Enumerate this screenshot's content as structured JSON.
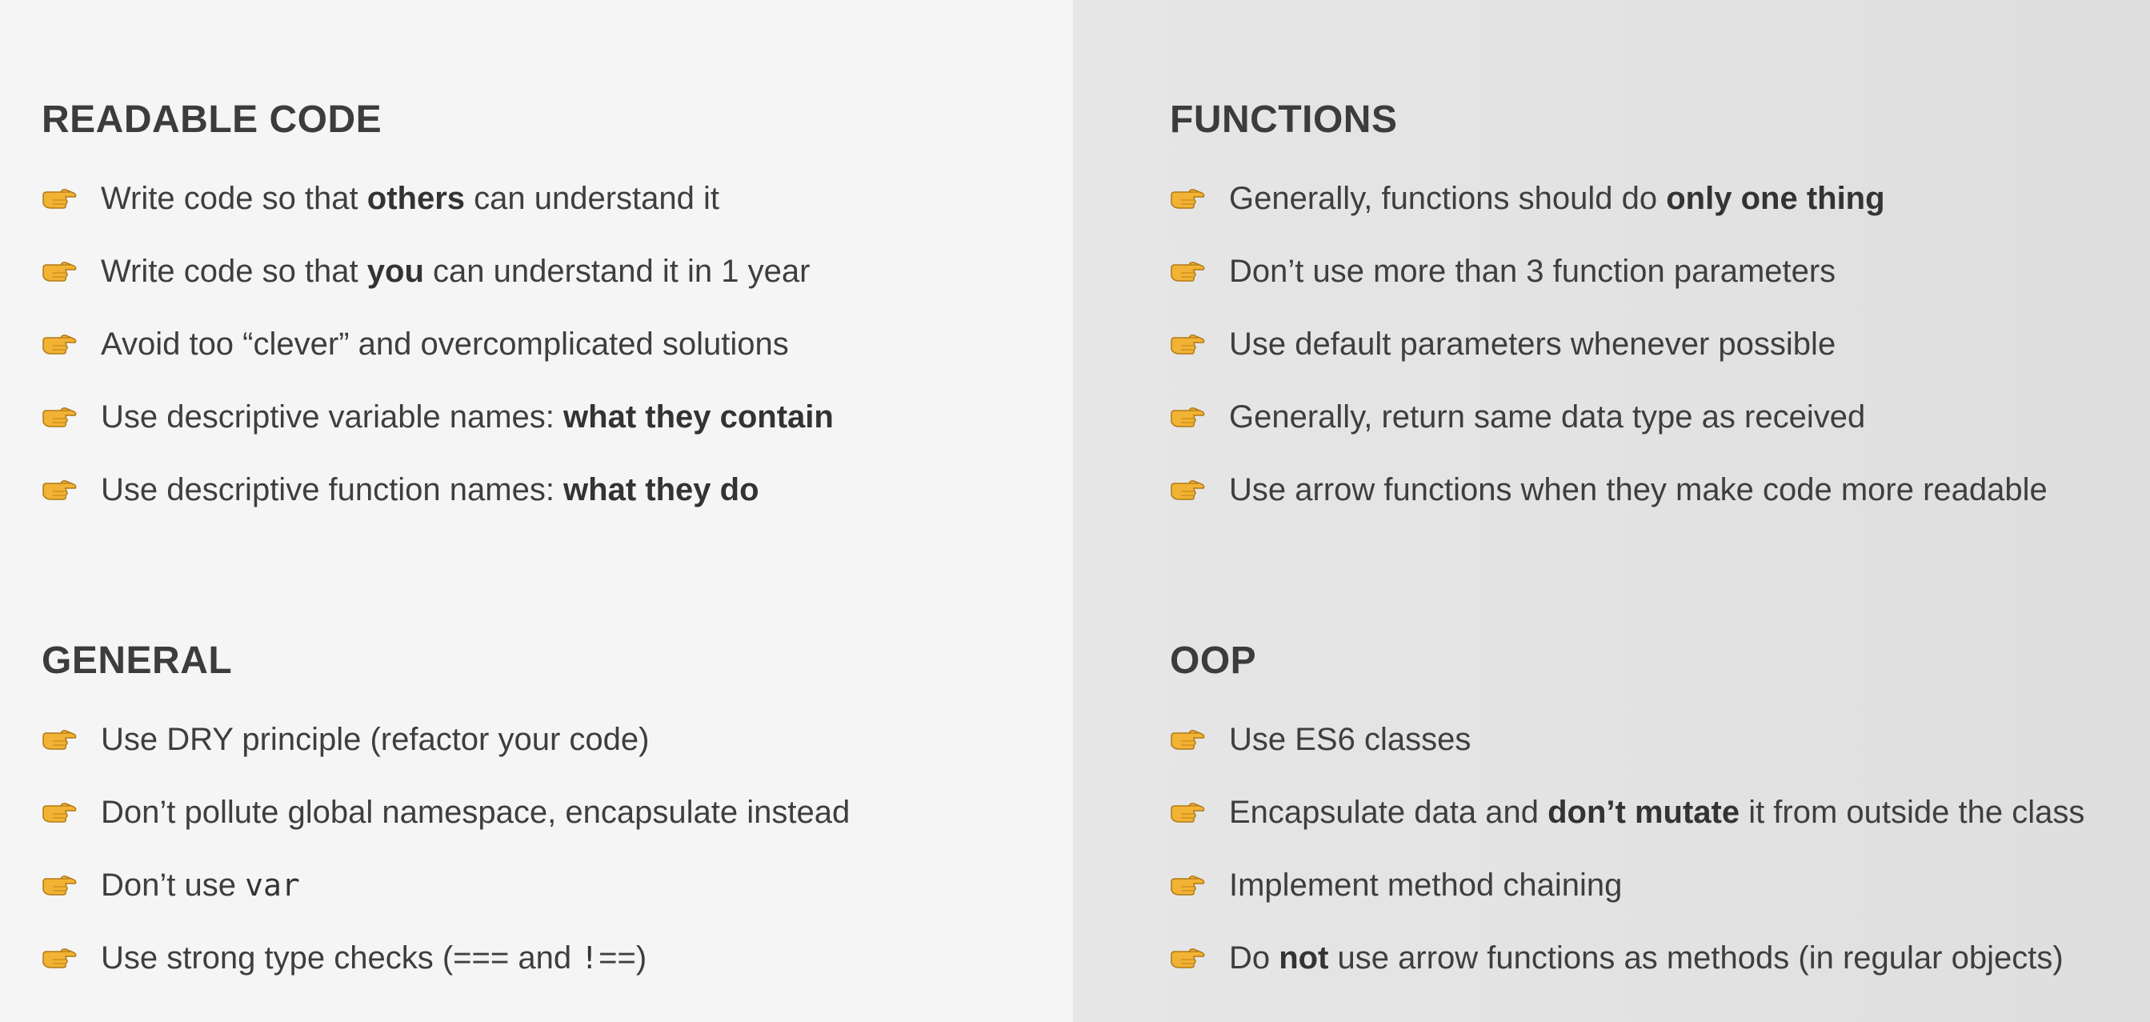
{
  "sections": {
    "readable": {
      "title": "READABLE CODE",
      "items": [
        {
          "a": "Write code so that ",
          "b": "others",
          "c": " can understand it"
        },
        {
          "a": "Write code so that ",
          "b": "you",
          "c": " can understand it in 1 year"
        },
        {
          "a": "Avoid too “clever” and overcomplicated solutions",
          "b": "",
          "c": ""
        },
        {
          "a": "Use descriptive variable names: ",
          "b": "what they contain",
          "c": ""
        },
        {
          "a": "Use descriptive function names: ",
          "b": "what they do",
          "c": ""
        }
      ]
    },
    "general": {
      "title": "GENERAL",
      "items": [
        {
          "a": "Use DRY principle (refactor your code)",
          "code": "",
          "c": ""
        },
        {
          "a": "Don’t pollute global namespace, encapsulate instead",
          "code": "",
          "c": ""
        },
        {
          "a": "Don’t use ",
          "code": "var",
          "c": ""
        },
        {
          "a": "Use strong type checks (=== and ",
          "code": "!",
          "c": "==)"
        }
      ]
    },
    "functions": {
      "title": "FUNCTIONS",
      "items": [
        {
          "a": "Generally, functions should do ",
          "b": "only one thing",
          "c": ""
        },
        {
          "a": "Don’t use more than 3 function parameters",
          "b": "",
          "c": ""
        },
        {
          "a": "Use default parameters whenever possible",
          "b": "",
          "c": ""
        },
        {
          "a": "Generally, return same data type as received",
          "b": "",
          "c": ""
        },
        {
          "a": "Use arrow functions when they make code more readable",
          "b": "",
          "c": ""
        }
      ]
    },
    "oop": {
      "title": "OOP",
      "items": [
        {
          "a": "Use ES6 classes",
          "b": "",
          "c": ""
        },
        {
          "a": "Encapsulate data and ",
          "b": "don’t mutate",
          "c": " it from outside the class"
        },
        {
          "a": "Implement method chaining",
          "b": "",
          "c": ""
        },
        {
          "a": "Do ",
          "b": "not",
          "c": " use arrow functions as methods (in regular objects)"
        }
      ]
    }
  },
  "icons": {
    "bullet": "pointing-hand-icon"
  },
  "colors": {
    "left_background": "#f5f5f5",
    "right_background": "#e2e2e2",
    "text": "#3e3e3e",
    "bullet": "#f2b233"
  }
}
